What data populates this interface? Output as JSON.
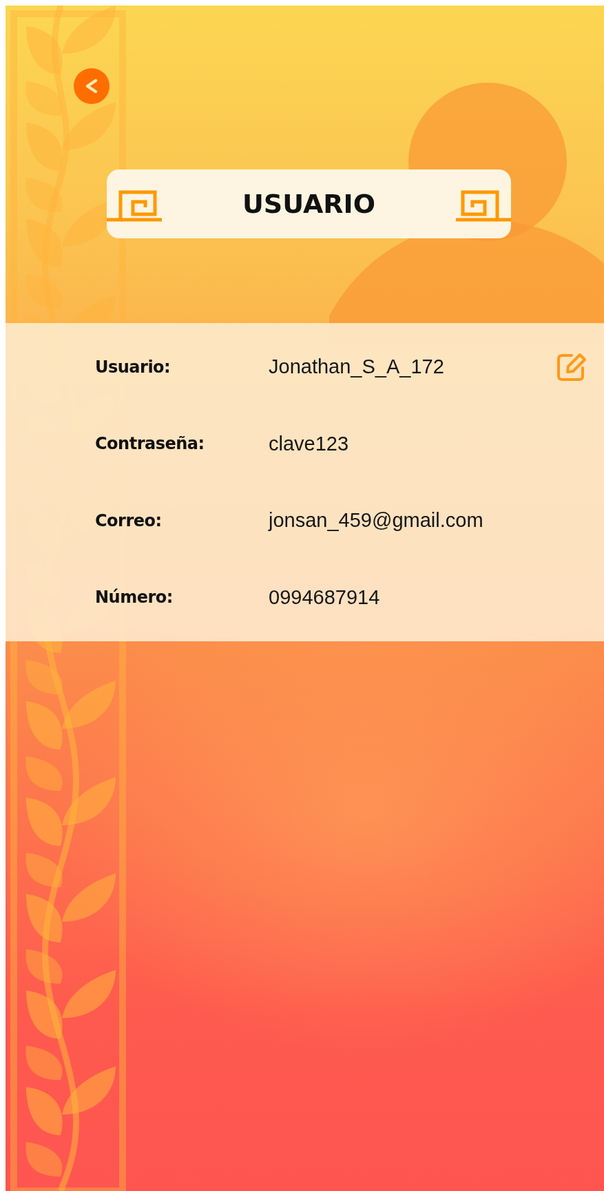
{
  "title": "USUARIO",
  "fields": [
    {
      "label": "Usuario:",
      "value": "Jonathan_S_A_172",
      "editable": true
    },
    {
      "label": "Contraseña:",
      "value": "clave123",
      "editable": false
    },
    {
      "label": "Correo:",
      "value": "jonsan_459@gmail.com",
      "editable": false
    },
    {
      "label": "Número:",
      "value": "0994687914",
      "editable": false
    }
  ]
}
